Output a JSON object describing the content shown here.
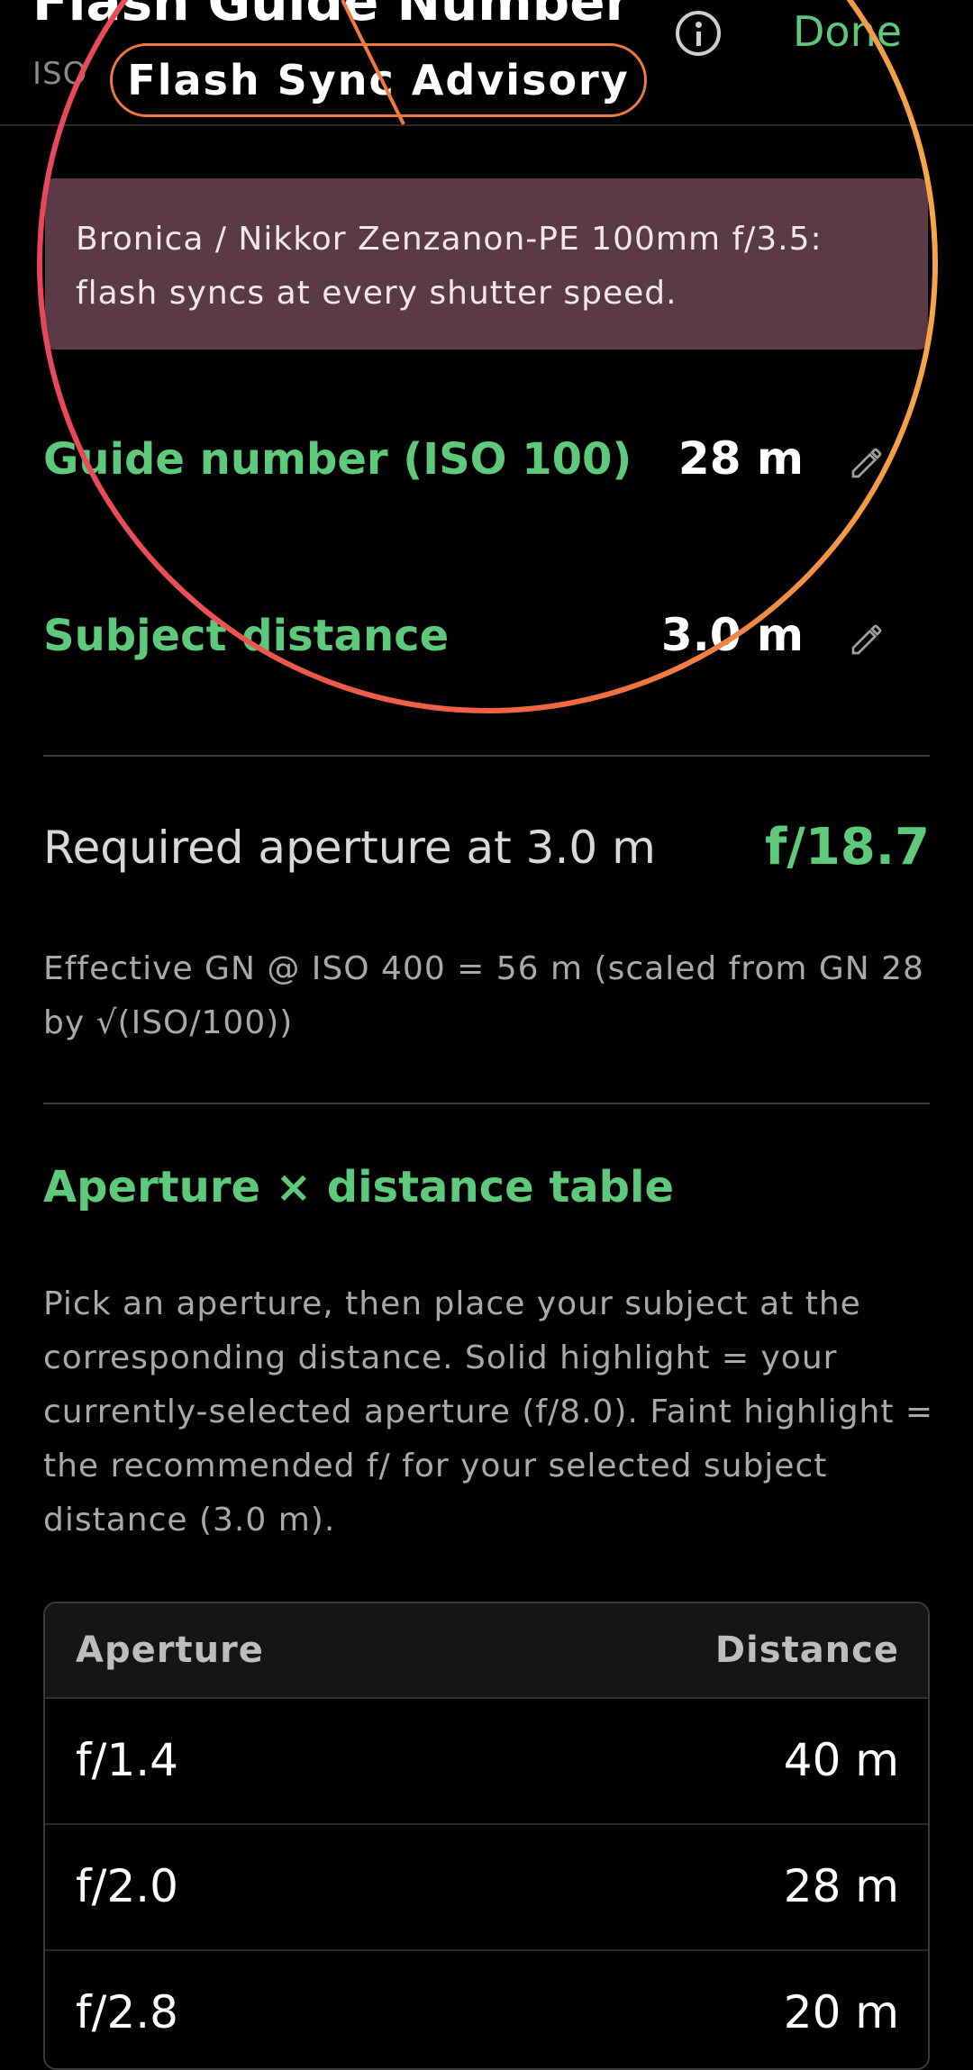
{
  "header": {
    "title": "Flash Guide Number",
    "subtitle": "ISO",
    "done_label": "Done"
  },
  "advisory": {
    "chip_label": "Flash Sync Advisory",
    "message": "Bronica / Nikkor Zenzanon-PE 100mm f/3.5: flash syncs at every shutter speed."
  },
  "inputs": {
    "guide_number_label": "Guide number (ISO 100)",
    "guide_number_value": "28 m",
    "subject_distance_label": "Subject distance",
    "subject_distance_value": "3.0 m"
  },
  "result": {
    "required_label": "Required aperture at 3.0 m",
    "required_value": "f/18.7",
    "effective_note": "Effective GN @ ISO 400 = 56 m (scaled from GN 28 by √(ISO/100))"
  },
  "table_section": {
    "title": "Aperture × distance table",
    "description": "Pick an aperture, then place your subject at the corresponding distance. Solid highlight = your currently-selected aperture (f/8.0). Faint highlight = the recommended f/ for your selected subject distance (3.0 m).",
    "columns": [
      "Aperture",
      "Distance"
    ],
    "rows": [
      {
        "aperture": "f/1.4",
        "distance": "40 m"
      },
      {
        "aperture": "f/2.0",
        "distance": "28 m"
      },
      {
        "aperture": "f/2.8",
        "distance": "20 m"
      }
    ]
  },
  "colors": {
    "accent": "#5ec97a",
    "banner_bg": "#5b3a48",
    "overlay_ring": "#f07a3c"
  }
}
